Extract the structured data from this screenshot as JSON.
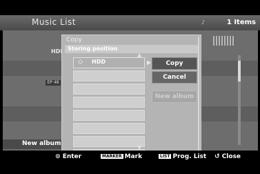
{
  "header": {
    "title": "Music List",
    "count": "1 Items"
  },
  "background": {
    "hdd_label": "HDD",
    "mini_label": "EP 48",
    "new_album": "New album"
  },
  "dialog": {
    "title": "Copy",
    "subtitle": "Storing position",
    "slots": [
      {
        "label": "HDD",
        "icon": "hdd-disc-icon",
        "selected": true
      },
      {
        "label": ""
      },
      {
        "label": ""
      },
      {
        "label": ""
      },
      {
        "label": ""
      },
      {
        "label": ""
      },
      {
        "label": ""
      },
      {
        "label": ""
      }
    ],
    "buttons": {
      "copy": "Copy",
      "cancel": "Cancel",
      "new_album": "New album"
    }
  },
  "footer": {
    "enter": "Enter",
    "marker_key": "MARKER",
    "mark": "Mark",
    "list_key": "LIST",
    "prog_list": "Prog. List",
    "close": "Close"
  }
}
